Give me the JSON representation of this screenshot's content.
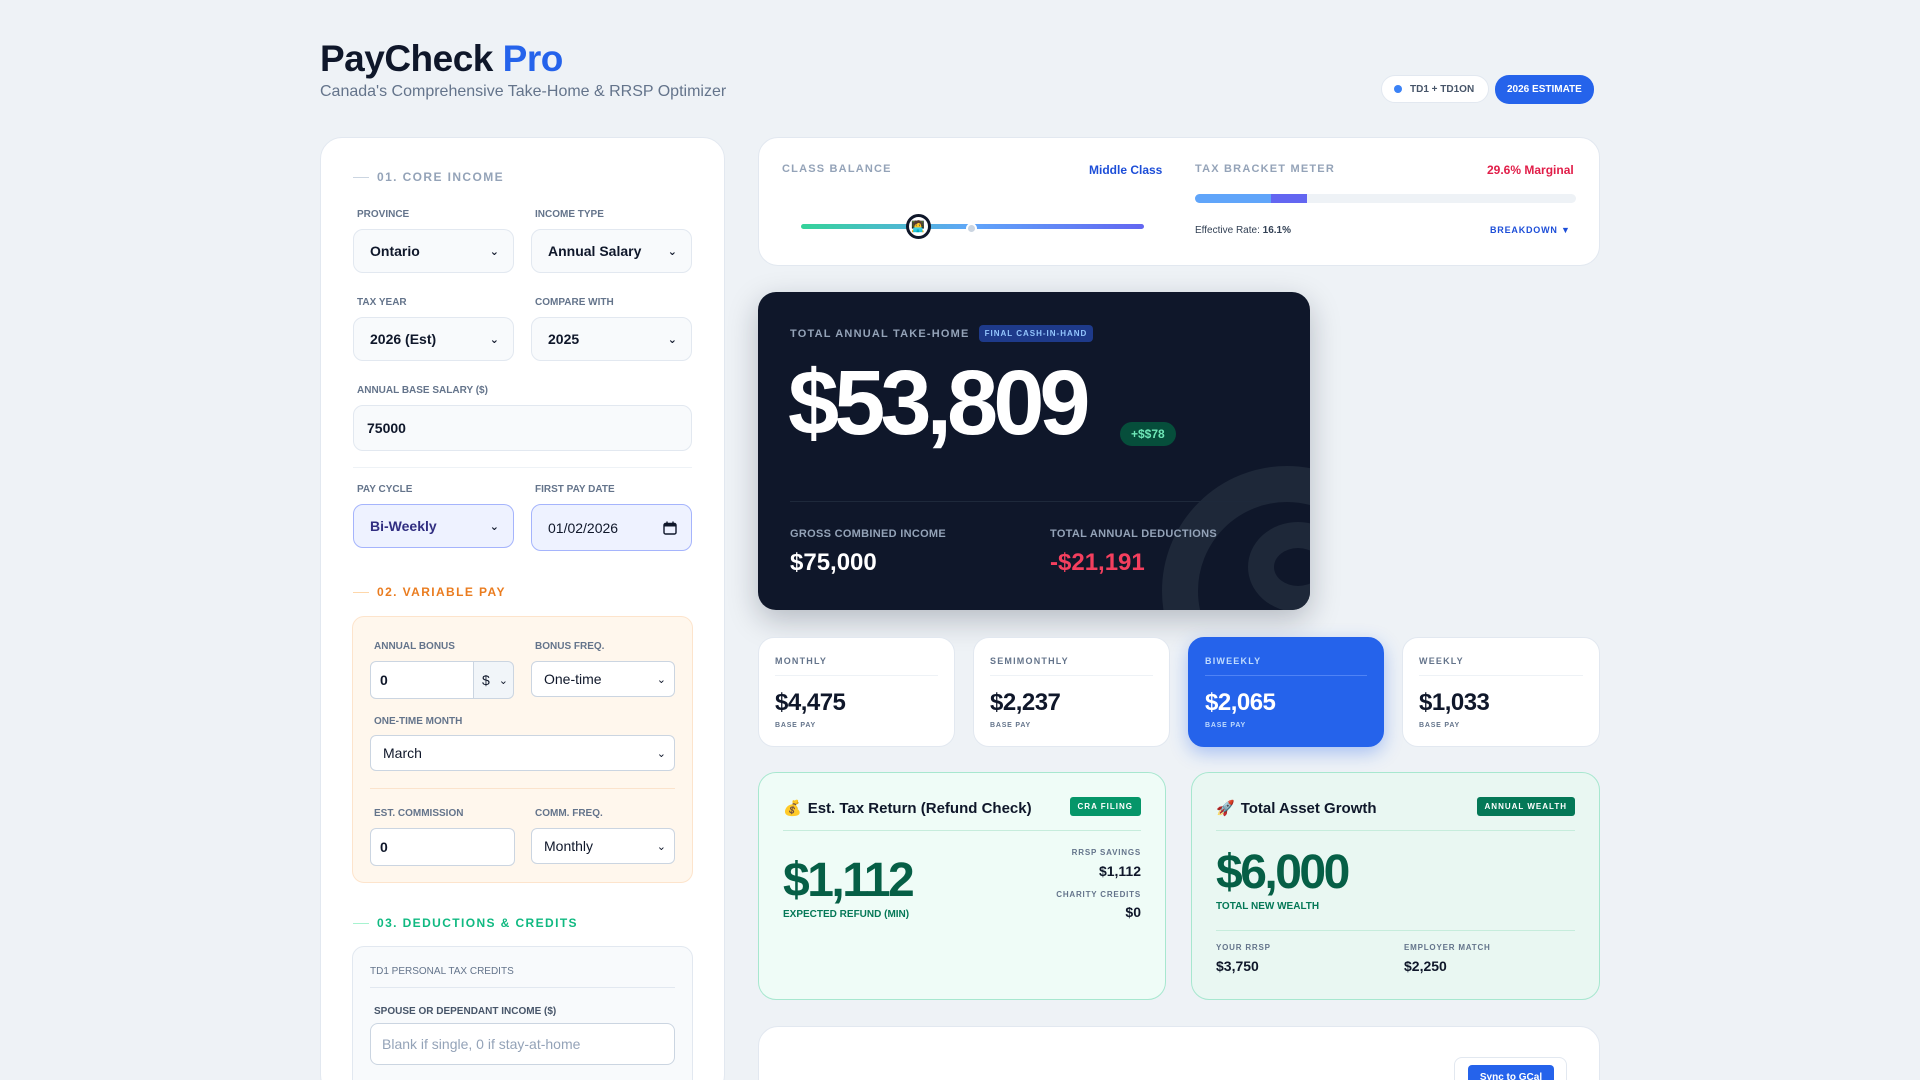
{
  "header": {
    "title_main": "PayCheck",
    "title_accent": "Pro",
    "subtitle": "Canada's Comprehensive Take-Home & RRSP Optimizer",
    "pill_td": "TD1 + TD1ON",
    "pill_estimate": "2026 ESTIMATE"
  },
  "core_income": {
    "section_title": "01. CORE INCOME",
    "province_label": "PROVINCE",
    "province_value": "Ontario",
    "income_type_label": "INCOME TYPE",
    "income_type_value": "Annual Salary",
    "tax_year_label": "TAX YEAR",
    "tax_year_value": "2026 (Est)",
    "compare_label": "COMPARE WITH",
    "compare_value": "2025",
    "salary_label": "ANNUAL BASE SALARY ($)",
    "salary_value": "75000",
    "pay_cycle_label": "PAY CYCLE",
    "pay_cycle_value": "Bi-Weekly",
    "first_pay_label": "FIRST PAY DATE",
    "first_pay_value": "01/02/2026"
  },
  "variable_pay": {
    "section_title": "02. VARIABLE PAY",
    "bonus_label": "ANNUAL BONUS",
    "bonus_value": "0",
    "bonus_unit": "$",
    "bonus_freq_label": "BONUS FREQ.",
    "bonus_freq_value": "One-time",
    "month_label": "ONE-TIME MONTH",
    "month_value": "March",
    "commission_label": "EST. COMMISSION",
    "commission_value": "0",
    "comm_freq_label": "COMM. FREQ.",
    "comm_freq_value": "Monthly"
  },
  "deductions": {
    "section_title": "03. DEDUCTIONS & CREDITS",
    "box_title": "TD1 PERSONAL TAX CREDITS",
    "spouse_label": "SPOUSE OR DEPENDANT INCOME ($)",
    "spouse_placeholder": "Blank if single, 0 if stay-at-home"
  },
  "meters": {
    "class_label": "CLASS BALANCE",
    "class_value": "Middle Class",
    "class_position": 0.34,
    "bracket_label": "TAX BRACKET METER",
    "bracket_value": "29.6% Marginal",
    "bracket_fill_light": 0.2,
    "bracket_fill_dark": 0.095,
    "effective_label": "Effective Rate:",
    "effective_value": "16.1%",
    "breakdown_label": "BREAKDOWN ▼"
  },
  "takehome": {
    "label": "TOTAL ANNUAL TAKE-HOME",
    "tag": "FINAL CASH-IN-HAND",
    "amount": "$53,809",
    "delta": "+$$78",
    "gross_label": "GROSS COMBINED INCOME",
    "gross_value": "$75,000",
    "deductions_label": "TOTAL ANNUAL DEDUCTIONS",
    "deductions_value": "-$21,191"
  },
  "frequencies": [
    {
      "label": "MONTHLY",
      "value": "$4,475",
      "sub": "BASE PAY"
    },
    {
      "label": "SEMIMONTHLY",
      "value": "$2,237",
      "sub": "BASE PAY"
    },
    {
      "label": "BIWEEKLY",
      "value": "$2,065",
      "sub": "BASE PAY"
    },
    {
      "label": "WEEKLY",
      "value": "$1,033",
      "sub": "BASE PAY"
    }
  ],
  "refund": {
    "emoji": "💰",
    "title": "Est. Tax Return (Refund Check)",
    "badge": "CRA FILING",
    "amount": "$1,112",
    "amount_sub": "EXPECTED REFUND (MIN)",
    "rrsp_label": "RRSP SAVINGS",
    "rrsp_value": "$1,112",
    "charity_label": "CHARITY CREDITS",
    "charity_value": "$0"
  },
  "assets": {
    "emoji": "🚀",
    "title": "Total Asset Growth",
    "badge": "ANNUAL WEALTH",
    "amount": "$6,000",
    "amount_sub": "TOTAL NEW WEALTH",
    "rrsp_label": "YOUR RRSP",
    "rrsp_value": "$3,750",
    "match_label": "EMPLOYER MATCH",
    "match_value": "$2,250"
  },
  "footer": {
    "gcal_button": "Sync to GCal"
  },
  "colors": {
    "accent": "#2563eb",
    "dark_card": "#0f172a",
    "variable_accent": "#ea7c1f",
    "deduction_accent": "#10b981",
    "marginal": "#e11d48",
    "negative": "#f43f5e"
  }
}
